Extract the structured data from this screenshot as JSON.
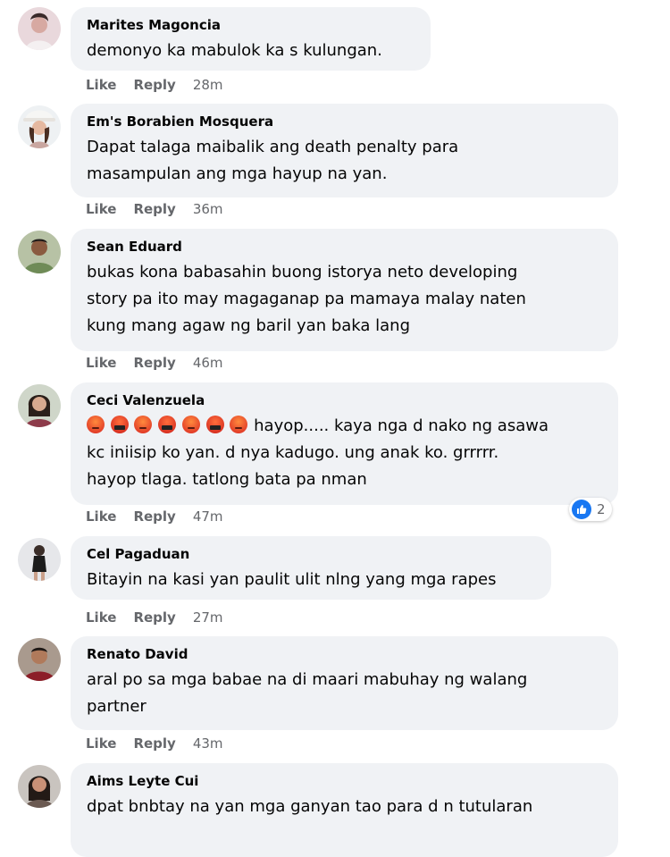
{
  "actions": {
    "like": "Like",
    "reply": "Reply"
  },
  "comments": [
    {
      "author": "Marites Magoncia",
      "lines": [
        "demonyo ka mabulok ka s kulungan."
      ],
      "time": "28m"
    },
    {
      "author": "Em's Borabien Mosquera",
      "lines": [
        "Dapat talaga maibalik ang death penalty para",
        "masampulan ang mga hayup na yan."
      ],
      "time": "36m"
    },
    {
      "author": "Sean Eduard",
      "lines": [
        "bukas kona babasahin buong istorya neto developing",
        "story pa ito may magaganap pa mamaya malay naten",
        "kung mang agaw ng baril yan baka lang"
      ],
      "time": "46m"
    },
    {
      "author": "Ceci Valenzuela",
      "line1_text": " hayop..... kaya nga d nako ng asawa",
      "lines": [
        "kc iniisip ko yan. d nya kadugo. ung anak ko. grrrrr.",
        "hayop tlaga. tatlong bata pa nman"
      ],
      "time": "47m",
      "reaction_count": "2"
    },
    {
      "author": "Cel Pagaduan",
      "lines": [
        "Bitayin na kasi yan paulit ulit nlng yang mga rapes"
      ],
      "time": "27m"
    },
    {
      "author": "Renato David",
      "lines": [
        "aral po sa mga babae na di maari mabuhay ng walang",
        "partner"
      ],
      "time": "43m"
    },
    {
      "author": "Aims Leyte Cui",
      "lines": [
        "dpat bnbtay na yan mga ganyan tao para d n tutularan"
      ]
    }
  ],
  "colors": {
    "bubble": "#f0f2f5",
    "text": "#050505",
    "meta": "#65676b",
    "like_blue": "#1877f2"
  },
  "icons": {
    "reaction": "like-icon",
    "emoji_angry": "angry-face-icon",
    "emoji_cursing": "cursing-face-icon"
  }
}
